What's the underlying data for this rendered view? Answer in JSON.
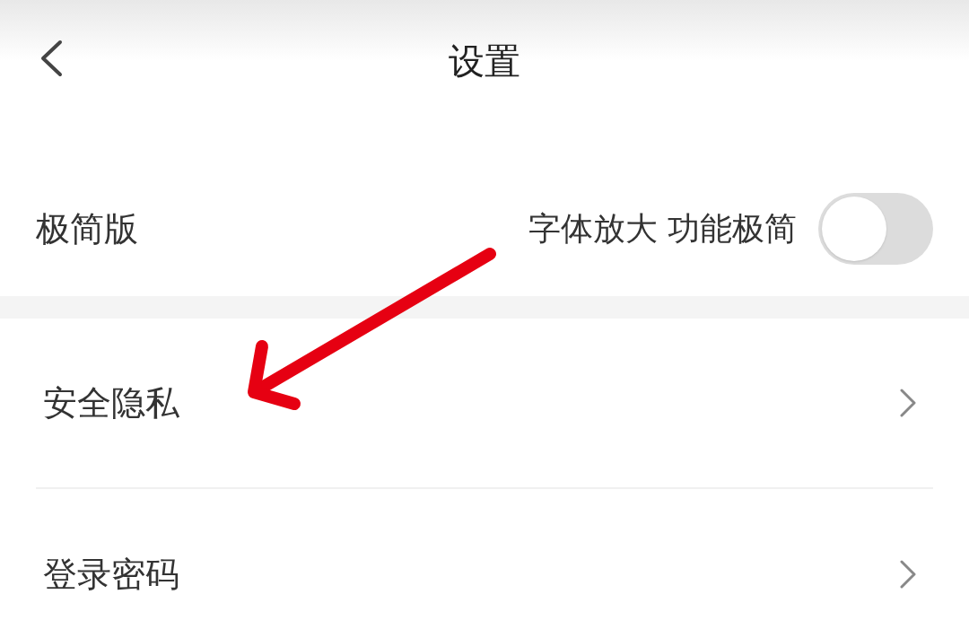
{
  "header": {
    "title": "设置"
  },
  "sections": [
    {
      "items": [
        {
          "kind": "toggle",
          "label": "极简版",
          "hint": "字体放大 功能极简",
          "on": false
        }
      ]
    },
    {
      "items": [
        {
          "kind": "link",
          "label": "安全隐私"
        },
        {
          "kind": "link",
          "label": "登录密码"
        }
      ]
    }
  ]
}
